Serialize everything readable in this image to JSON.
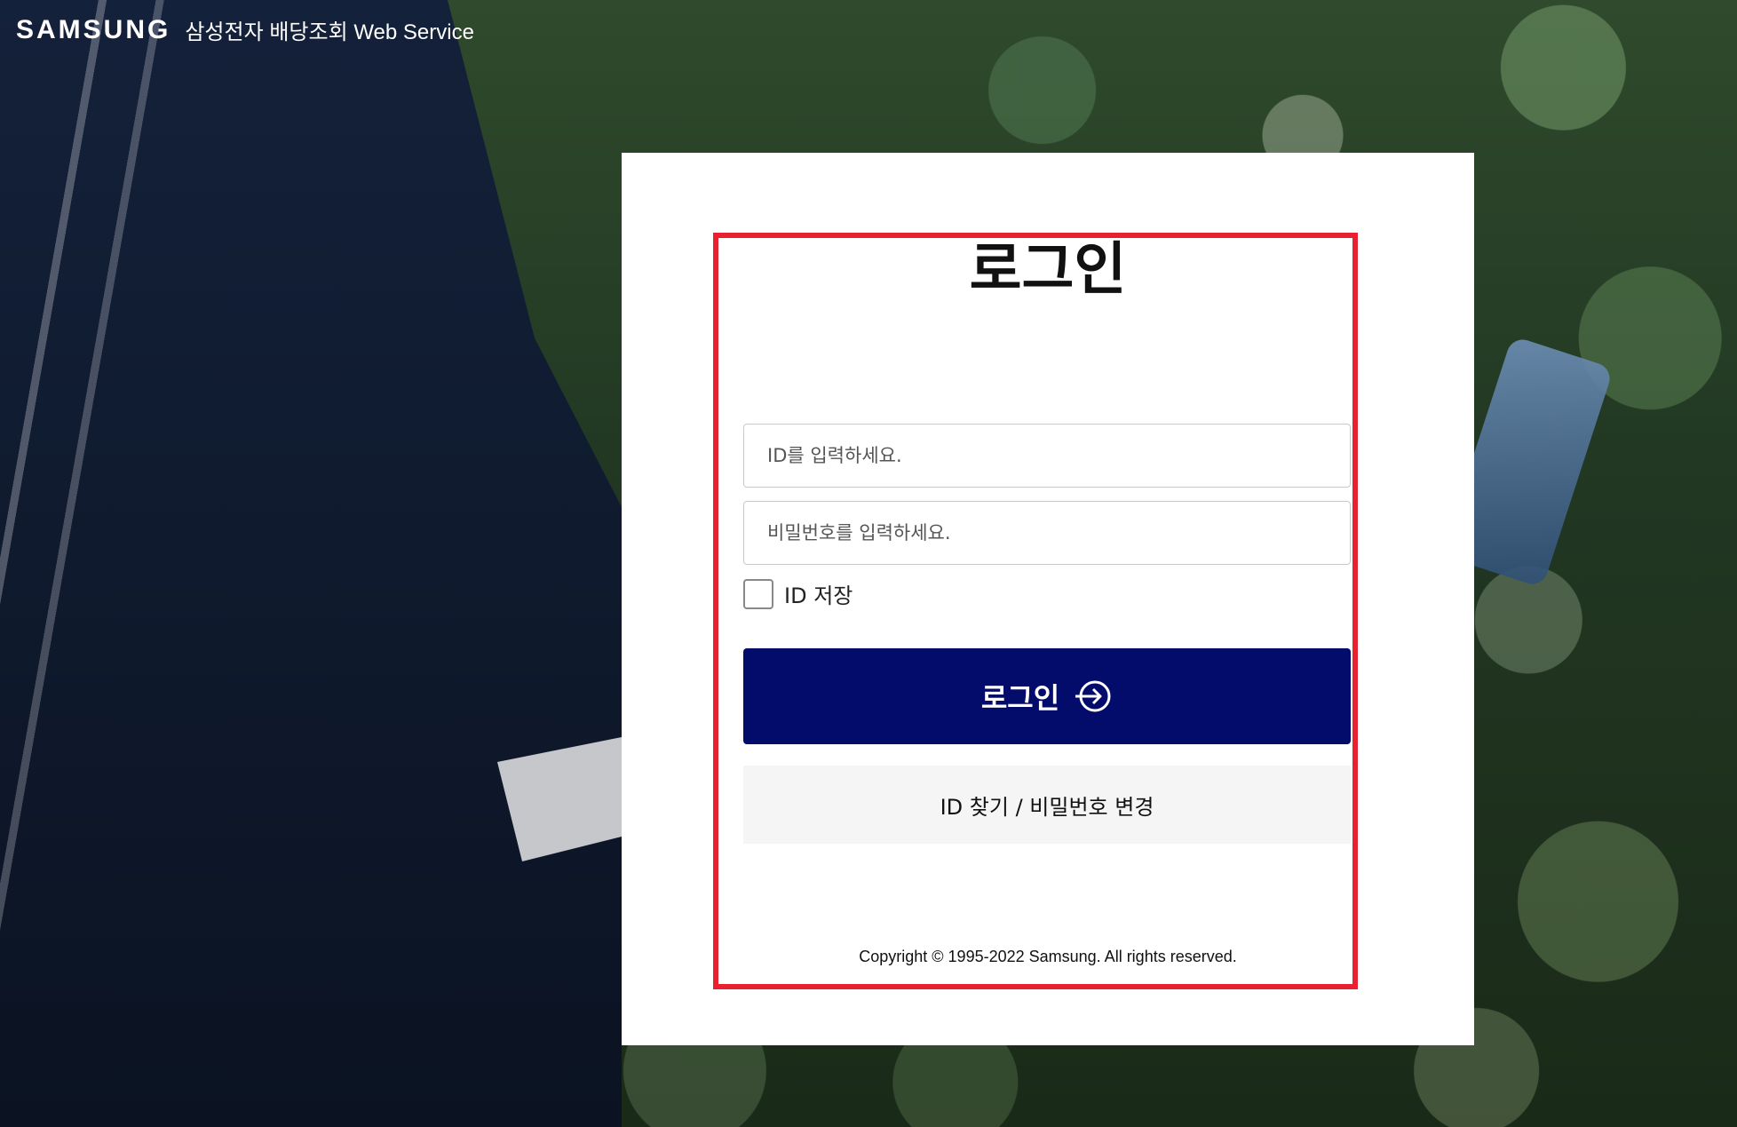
{
  "header": {
    "logo": "SAMSUNG",
    "service_name": "삼성전자 배당조회 Web Service"
  },
  "login": {
    "title": "로그인",
    "id_placeholder": "ID를 입력하세요.",
    "password_placeholder": "비밀번호를 입력하세요.",
    "remember_label": "ID 저장",
    "remember_checked": false,
    "login_button_label": "로그인",
    "find_button_label": "ID 찾기 / 비밀번호 변경",
    "copyright": "Copyright © 1995-2022 Samsung. All rights reserved."
  },
  "colors": {
    "primary_button": "#030c6b",
    "highlight_border": "#e8202f",
    "secondary_button": "#f5f5f5"
  },
  "icons": {
    "login_button_icon": "arrow-right-circle-icon"
  }
}
